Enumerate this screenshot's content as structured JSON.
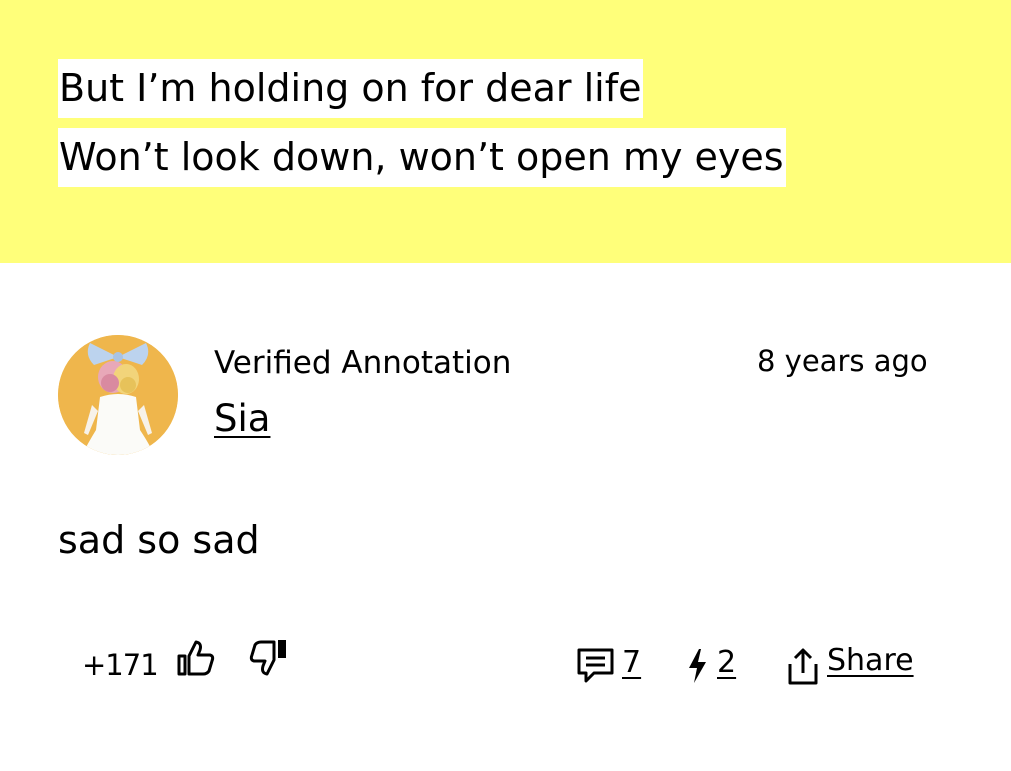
{
  "lyrics": {
    "lines": [
      "But I’m holding on for dear life",
      "Won’t look down, won’t open my eyes"
    ],
    "highlight_color": "#ffff7a"
  },
  "annotation": {
    "verified_label": "Verified Annotation",
    "author": "Sia",
    "timestamp": "8 years ago",
    "body": "sad so sad",
    "avatar_icon": "artist-avatar"
  },
  "actions": {
    "vote_count": "+171",
    "upvote_icon": "thumbs-up-icon",
    "downvote_icon": "thumbs-down-icon",
    "comments_icon": "comment-icon",
    "comments_count": "7",
    "pyong_icon": "lightning-icon",
    "pyong_count": "2",
    "share_icon": "share-icon",
    "share_label": "Share"
  }
}
